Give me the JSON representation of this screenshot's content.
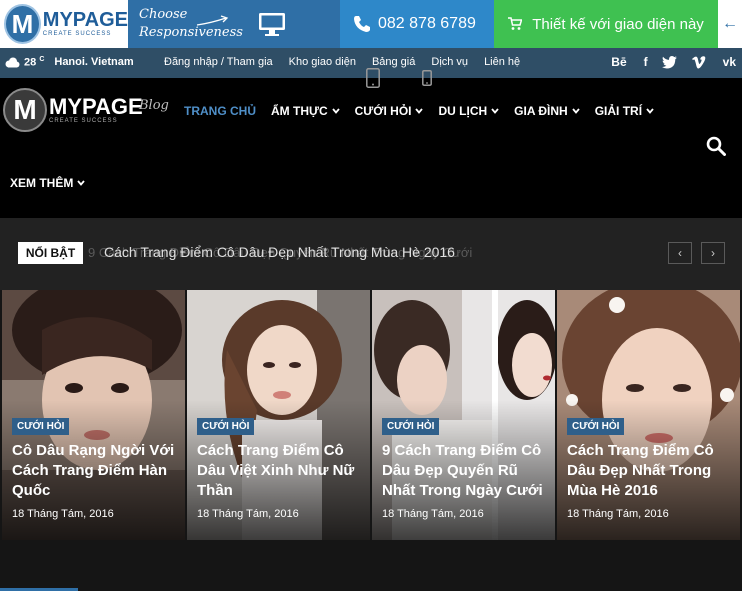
{
  "promo": {
    "logo_letter": "M",
    "logo_name": "MYPAGE",
    "logo_tag": "CREATE SUCCESS",
    "choose_line1": "Choose",
    "choose_line2": "Responsiveness",
    "phone": "082 878 6789",
    "design_btn": "Thiết kế với giao diện này",
    "monitor_icon": "monitor-icon",
    "cart_icon": "cart-icon"
  },
  "topbar": {
    "temp": "28",
    "temp_unit": "C",
    "city": "Hanoi. Vietnam",
    "links": [
      "Đăng nhập / Tham gia",
      "Kho giao diện",
      "Bảng giá",
      "Dịch vụ",
      "Liên hệ"
    ],
    "social": [
      "Bē",
      "f",
      "twitter",
      "vimeo",
      "vk"
    ]
  },
  "header": {
    "logo_letter": "M",
    "logo_name": "MYPAGE",
    "logo_blog": "Blog",
    "logo_tag": "CREATE SUCCESS",
    "nav": [
      {
        "label": "TRANG CHỦ"
      },
      {
        "label": "ẨM THỰC"
      },
      {
        "label": "CƯỚI HỎI"
      },
      {
        "label": "DU LỊCH"
      },
      {
        "label": "GIA ĐÌNH"
      },
      {
        "label": "GIẢI TRÍ"
      }
    ],
    "more": "XEM THÊM"
  },
  "ticker": {
    "label": "NỔI BẬT",
    "ghost": "9 Cách Trang Điểm Cô Dâu Đẹp Quyến Rũ Nhất Trong Ngày Cưới",
    "title": "Cách Trang Điểm Cô Dâu Đẹp Nhất Trong Mùa Hè 2016",
    "prev": "‹",
    "next": "›"
  },
  "cards": [
    {
      "category": "CƯỚI HỎI",
      "title": "Cô Dâu Rạng Ngời Với Cách Trang Điểm Hàn Quốc",
      "date": "18 Tháng Tám, 2016"
    },
    {
      "category": "CƯỚI HỎI",
      "title": "Cách Trang Điểm Cô Dâu Việt Xinh Như Nữ Thần",
      "date": "18 Tháng Tám, 2016"
    },
    {
      "category": "CƯỚI HỎI",
      "title": "9 Cách Trang Điểm Cô Dâu Đẹp Quyến Rũ Nhất Trong Ngày Cưới",
      "date": "18 Tháng Tám, 2016"
    },
    {
      "category": "CƯỚI HỎI",
      "title": "Cách Trang Điểm Cô Dâu Đẹp Nhất Trong Mùa Hè 2016",
      "date": "18 Tháng Tám, 2016"
    }
  ],
  "colors": {
    "promo_blue": "#2f6fa6",
    "phone_blue": "#2e88c9",
    "cta_green": "#3fc151",
    "topbar": "#2f4e66",
    "nav_active": "#4f8fc8",
    "badge": "#2f5f8a"
  }
}
